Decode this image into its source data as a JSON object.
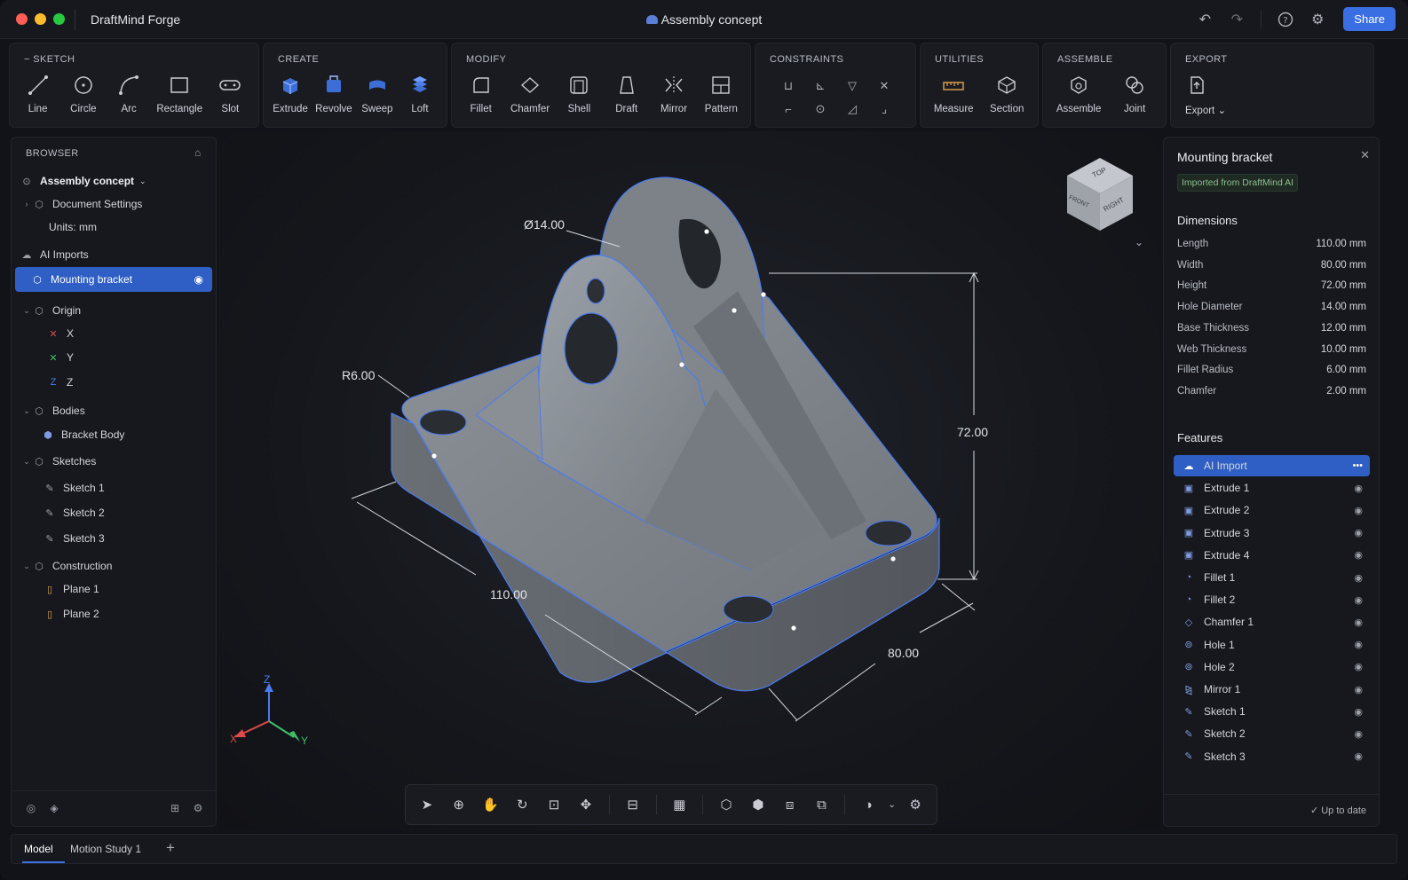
{
  "title_bar": {
    "app_name": "DraftMind Forge",
    "document_title": "Assembly concept",
    "share_label": "Share"
  },
  "ribbon": {
    "sketch": {
      "title": "SKETCH",
      "tools": [
        "Line",
        "Circle",
        "Arc",
        "Rectangle",
        "Slot"
      ]
    },
    "create": {
      "title": "CREATE",
      "tools": [
        "Extrude",
        "Revolve",
        "Sweep",
        "Loft"
      ]
    },
    "modify": {
      "title": "MODIFY",
      "tools": [
        "Fillet",
        "Chamfer",
        "Shell",
        "Draft",
        "Mirror",
        "Pattern"
      ]
    },
    "constraints": {
      "title": "CONSTRAINTS"
    },
    "utilities": {
      "title": "UTILITIES",
      "tools": [
        "Measure",
        "Section"
      ]
    },
    "assemble": {
      "title": "ASSEMBLE",
      "tools": [
        "Assemble",
        "Joint"
      ]
    },
    "export": {
      "title": "EXPORT",
      "tools": [
        "Export"
      ]
    }
  },
  "browser": {
    "title": "BROWSER",
    "root": "Assembly concept",
    "document_settings": "Document Settings",
    "units": "Units: mm",
    "ai_imports": "AI Imports",
    "selected_item": "Mounting bracket",
    "origin": "Origin",
    "axes": [
      "X",
      "Y",
      "Z"
    ],
    "bodies": "Bodies",
    "bracket_body": "Bracket Body",
    "sketches": "Sketches",
    "sketch_items": [
      "Sketch 1",
      "Sketch 2",
      "Sketch 3"
    ],
    "construction": "Construction",
    "plane_items": [
      "Plane 1",
      "Plane 2"
    ]
  },
  "viewport": {
    "dim_diameter": "Ø14.00",
    "dim_radius": "R6.00",
    "dim_height": "72.00",
    "dim_length": "110.00",
    "dim_width": "80.00",
    "viewcube_top": "TOP",
    "viewcube_right": "RIGHT",
    "viewcube_front": "FRONT",
    "triad": {
      "z": "Z",
      "x": "X",
      "y": "Y"
    }
  },
  "properties": {
    "title": "Mounting bracket",
    "badge": "Imported from DraftMind AI",
    "dimensions_heading": "Dimensions",
    "dimensions": [
      {
        "label": "Length",
        "value": "110.00 mm"
      },
      {
        "label": "Width",
        "value": "80.00 mm"
      },
      {
        "label": "Height",
        "value": "72.00 mm"
      },
      {
        "label": "Hole Diameter",
        "value": "14.00 mm"
      },
      {
        "label": "Base Thickness",
        "value": "12.00 mm"
      },
      {
        "label": "Web Thickness",
        "value": "10.00 mm"
      },
      {
        "label": "Fillet Radius",
        "value": "6.00 mm"
      },
      {
        "label": "Chamfer",
        "value": "2.00 mm"
      }
    ],
    "features_heading": "Features",
    "features": [
      "AI Import",
      "Extrude 1",
      "Extrude 2",
      "Extrude 3",
      "Extrude 4",
      "Fillet 1",
      "Fillet 2",
      "Chamfer 1",
      "Hole 1",
      "Hole 2",
      "Mirror 1",
      "Sketch 1",
      "Sketch 2",
      "Sketch 3"
    ],
    "status": "Up to date"
  },
  "bottom_tabs": [
    "Model",
    "Motion Study 1"
  ],
  "colors": {
    "accent": "#3a6fe3",
    "selection": "#2f5fc4",
    "edge_highlight": "#4a7cf0",
    "axis_x": "#e04a4a",
    "axis_y": "#3fbf6a",
    "axis_z": "#4a7cf0"
  }
}
